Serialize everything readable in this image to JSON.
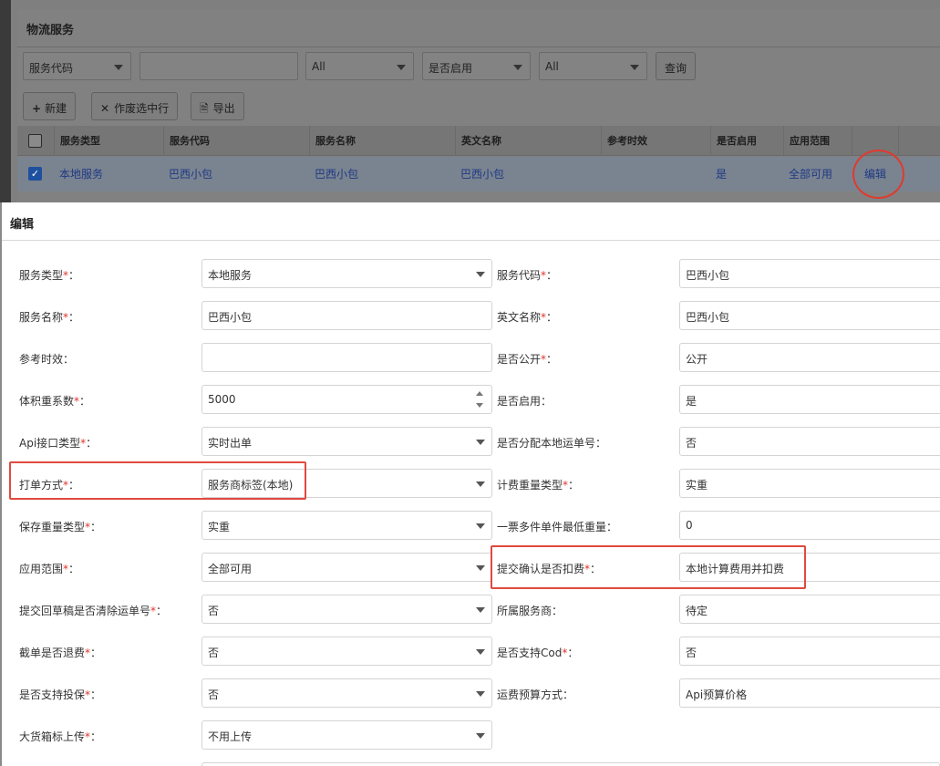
{
  "panel": {
    "title": "物流服务"
  },
  "filters": {
    "field_select": "服务代码",
    "text_input": "",
    "status_select": "All",
    "enabled_label": "是否启用",
    "enabled_select": "All",
    "query_button": "查询"
  },
  "toolbar": {
    "new_button": "新建",
    "void_button": "作废选中行",
    "export_button": "导出"
  },
  "table": {
    "headers": [
      "服务类型",
      "服务代码",
      "服务名称",
      "英文名称",
      "参考时效",
      "是否启用",
      "应用范围"
    ],
    "rows": [
      {
        "type": "本地服务",
        "code": "巴西小包",
        "name": "巴西小包",
        "en_name": "巴西小包",
        "ref_time": "",
        "enabled": "是",
        "scope": "全部可用",
        "action": "编辑"
      }
    ]
  },
  "modal": {
    "title": "编辑",
    "fields": [
      {
        "label": "服务类型",
        "required": "*",
        "value": "本地服务"
      },
      {
        "label": "服务代码",
        "required": "*",
        "value": "巴西小包"
      },
      {
        "label": "服务名称",
        "required": "*",
        "value": "巴西小包"
      },
      {
        "label": "英文名称",
        "required": "*",
        "value": "巴西小包"
      },
      {
        "label": "参考时效",
        "required": "",
        "value": ""
      },
      {
        "label": "是否公开",
        "required": "*",
        "value": "公开"
      },
      {
        "label": "体积重系数",
        "required": "*",
        "value": "5000"
      },
      {
        "label": "是否启用",
        "required": "",
        "value": "是"
      },
      {
        "label": "Api接口类型",
        "required": "*",
        "value": "实时出单"
      },
      {
        "label": "是否分配本地运单号",
        "required": "",
        "value": "否"
      },
      {
        "label": "打单方式",
        "required": "*",
        "value": "服务商标签(本地)"
      },
      {
        "label": "计费重量类型",
        "required": "*",
        "value": "实重"
      },
      {
        "label": "保存重量类型",
        "required": "*",
        "value": "实重"
      },
      {
        "label": "一票多件单件最低重量",
        "required": "",
        "value": "0"
      },
      {
        "label": "应用范围",
        "required": "*",
        "value": "全部可用"
      },
      {
        "label": "提交确认是否扣费",
        "required": "*",
        "value": "本地计算费用并扣费"
      },
      {
        "label": "提交回草稿是否清除运单号",
        "required": "*",
        "value": "否"
      },
      {
        "label": "所属服务商",
        "required": "",
        "value": "待定"
      },
      {
        "label": "截单是否退费",
        "required": "*",
        "value": "否"
      },
      {
        "label": "是否支持Cod",
        "required": "*",
        "value": "否"
      },
      {
        "label": "是否支持投保",
        "required": "*",
        "value": "否"
      },
      {
        "label": "运费预算方式",
        "required": "",
        "value": "Api预算价格"
      },
      {
        "label": "大货箱标上传",
        "required": "*",
        "value": "不用上传"
      }
    ]
  },
  "colors": {
    "required_mark": "#e0322b",
    "highlight": "#e04a3f",
    "link": "#1f3a84"
  }
}
